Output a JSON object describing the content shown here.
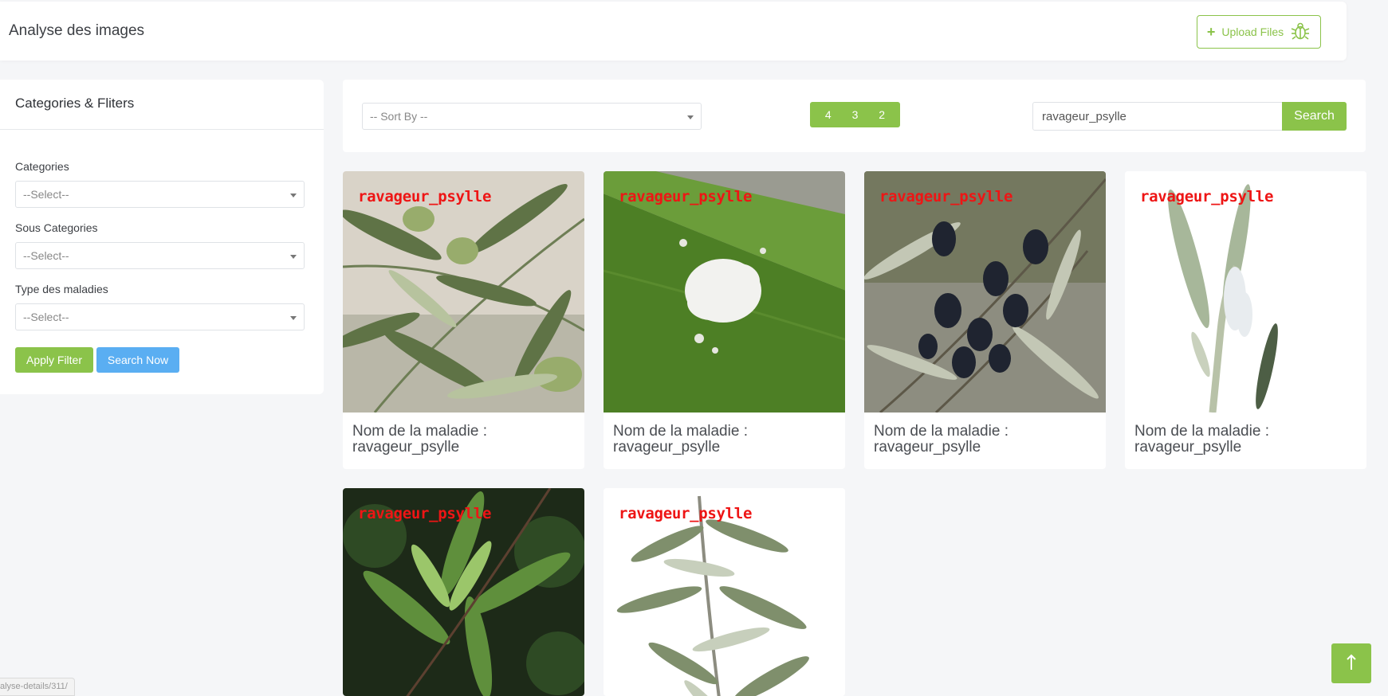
{
  "header": {
    "title": "Analyse des images",
    "upload_label": "Upload Files",
    "upload_icon": "bug-icon"
  },
  "sidebar": {
    "title": "Categories & Fliters",
    "filters": [
      {
        "label": "Categories",
        "value": "--Select--"
      },
      {
        "label": "Sous Categories",
        "value": "--Select--"
      },
      {
        "label": "Type des maladies",
        "value": "--Select--"
      }
    ],
    "apply_label": "Apply Filter",
    "search_now_label": "Search Now"
  },
  "toolbar": {
    "sort_value": "-- Sort By --",
    "pages": [
      "4",
      "3",
      "2"
    ],
    "search_value": "ravageur_psylle",
    "search_label": "Search"
  },
  "cards": [
    {
      "overlay": "ravageur_psylle",
      "caption_prefix": "Nom de la maladie :",
      "caption_value": "ravageur_psylle"
    },
    {
      "overlay": "ravageur_psylle",
      "caption_prefix": "Nom de la maladie :",
      "caption_value": "ravageur_psylle"
    },
    {
      "overlay": "ravageur_psylle",
      "caption_prefix": "Nom de la maladie :",
      "caption_value": "ravageur_psylle"
    },
    {
      "overlay": "ravageur_psylle",
      "caption_prefix": "Nom de la maladie :",
      "caption_value": "ravageur_psylle"
    },
    {
      "overlay": "ravageur_psylle"
    },
    {
      "overlay": "ravageur_psylle"
    }
  ],
  "status_url": "alyse-details/311/",
  "colors": {
    "accent": "#8bc34a",
    "secondary": "#5aaef2",
    "overlay_text": "#ee1515"
  }
}
